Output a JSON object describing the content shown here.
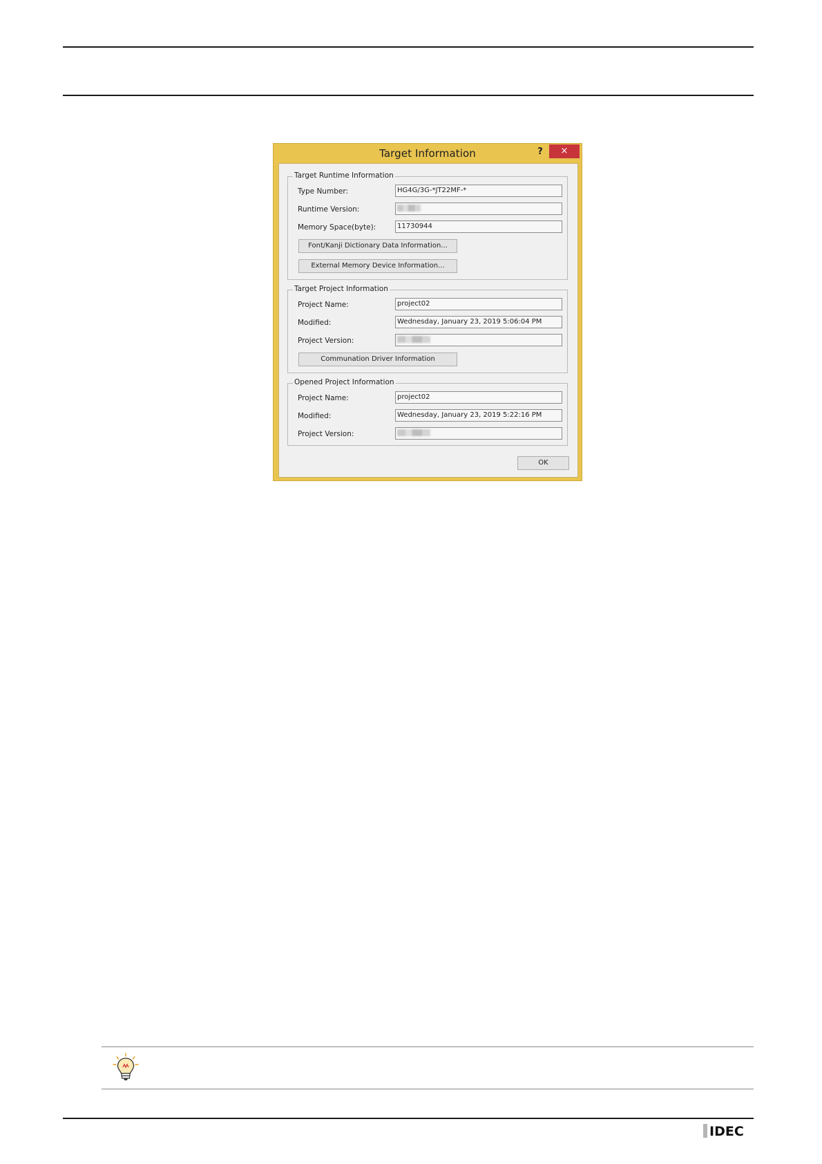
{
  "dialog": {
    "title": "Target Information",
    "help_label": "?",
    "close_label": "×",
    "runtime_group": {
      "legend": "Target Runtime Information",
      "type_number_label": "Type Number:",
      "type_number_value": "HG4G/3G-*JT22MF-*",
      "runtime_version_label": "Runtime Version:",
      "memory_space_label": "Memory Space(byte):",
      "memory_space_value": "11730944",
      "font_button": "Font/Kanji Dictionary Data Information...",
      "memory_button": "External Memory Device Information..."
    },
    "target_project_group": {
      "legend": "Target Project Information",
      "project_name_label": "Project Name:",
      "project_name_value": "project02",
      "modified_label": "Modified:",
      "modified_value": "Wednesday, January 23, 2019 5:06:04 PM",
      "project_version_label": "Project Version:",
      "driver_button": "Communation Driver Information"
    },
    "opened_project_group": {
      "legend": "Opened Project Information",
      "project_name_label": "Project Name:",
      "project_name_value": "project02",
      "modified_label": "Modified:",
      "modified_value": "Wednesday, January 23, 2019 5:22:16 PM",
      "project_version_label": "Project Version:"
    },
    "ok_label": "OK"
  },
  "logo": {
    "text": "IDEC"
  },
  "icons": {
    "hint": "lightbulb-icon"
  }
}
